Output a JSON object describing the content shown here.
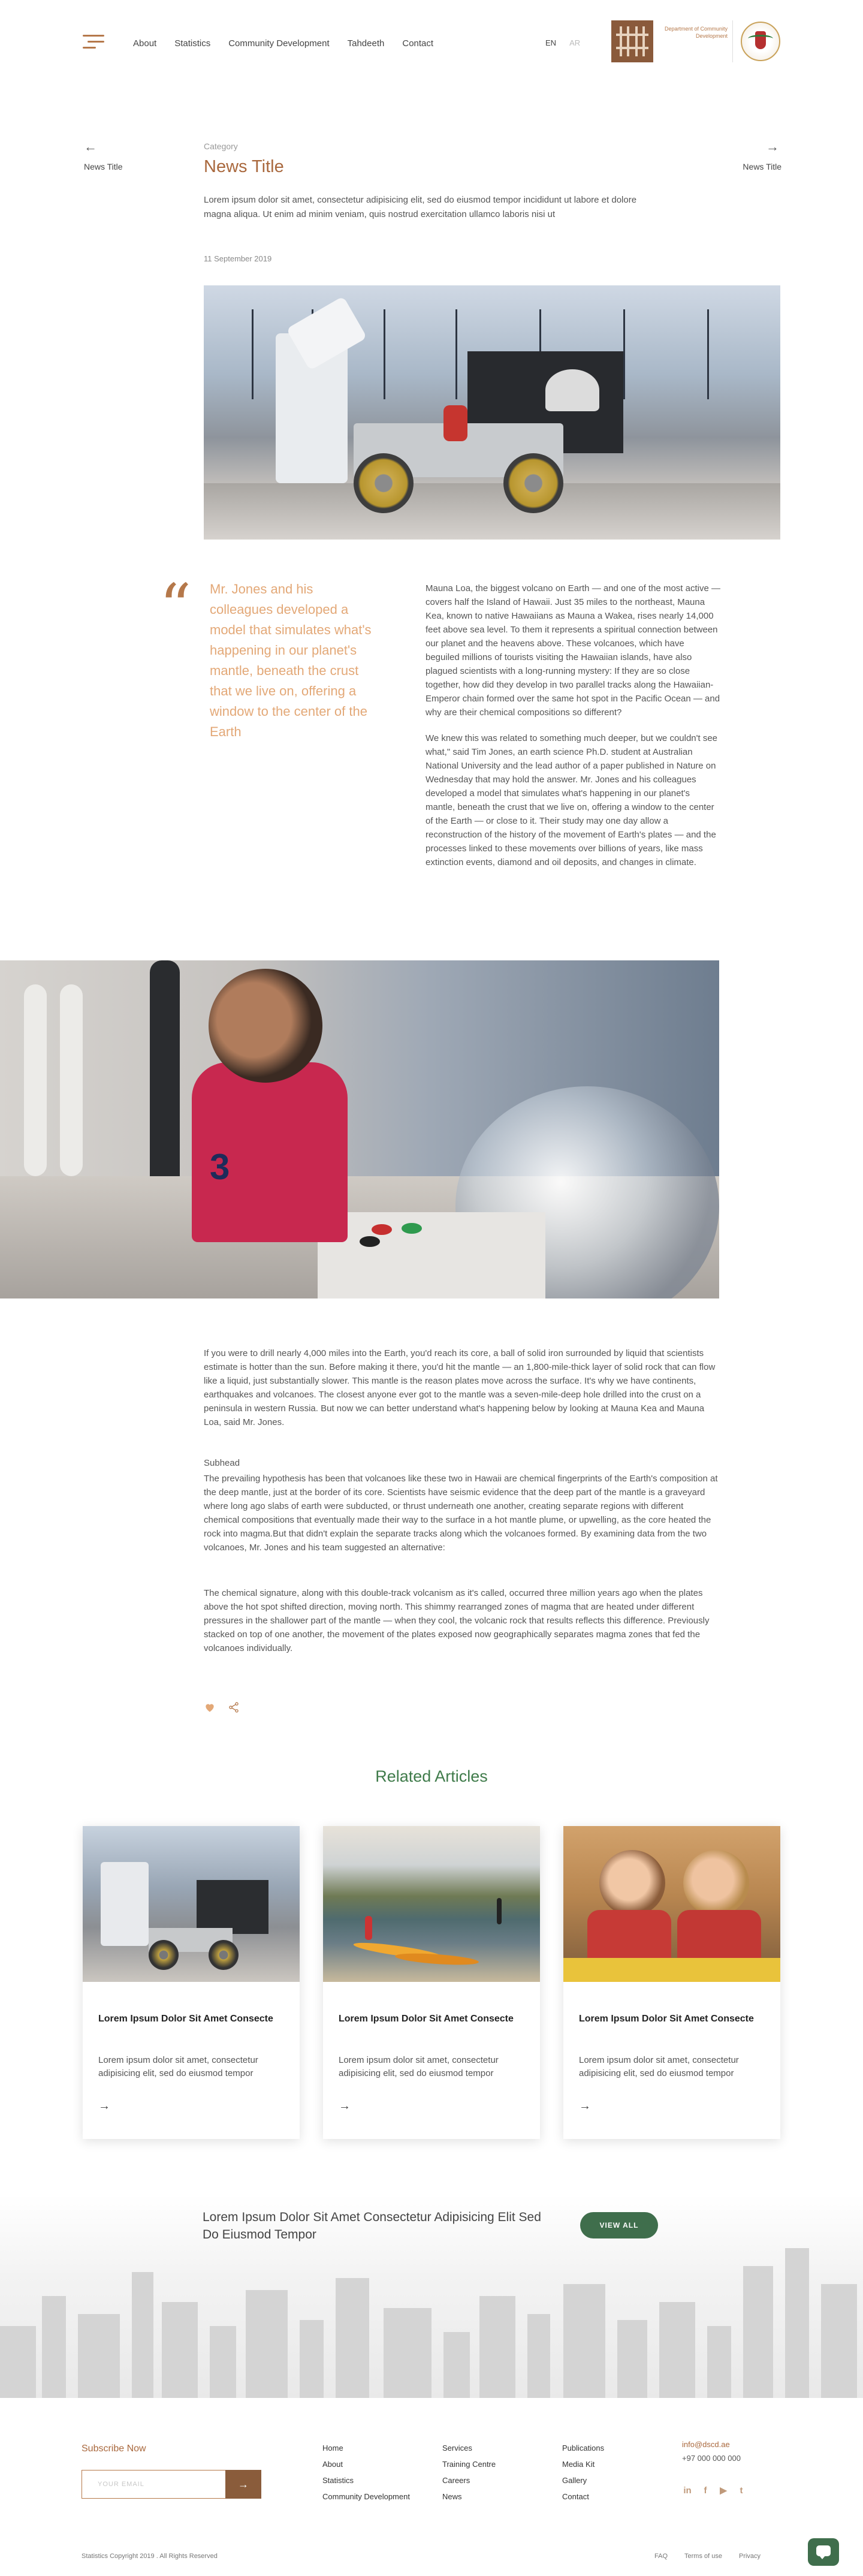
{
  "header": {
    "nav": [
      "About",
      "Statistics",
      "Community Development",
      "Tahdeeth",
      "Contact"
    ],
    "lang_en": "EN",
    "lang_ar": "AR",
    "logo_text": "Department of Community Development",
    "menu_icon": "hamburger-menu-icon"
  },
  "article_nav": {
    "prev_label": "News Title",
    "next_label": "News Title",
    "prev_icon": "arrow-left-icon",
    "next_icon": "arrow-right-icon"
  },
  "article": {
    "category": "Category",
    "title": "News Title",
    "intro": "Lorem ipsum dolor sit amet, consectetur adipisicing elit, sed do eiusmod tempor incididunt ut labore et dolore magna aliqua. Ut enim ad minim veniam, quis nostrud exercitation ullamco laboris nisi ut",
    "date": "11 September 2019",
    "pull_quote": "Mr. Jones and his colleagues developed a model that simulates what's happening in our planet's mantle, beneath the crust that we live on, offering a window to the center of the Earth",
    "body_p1": "Mauna Loa, the biggest volcano on Earth — and one of the most active — covers half the Island of Hawaii. Just 35 miles to the northeast, Mauna Kea, known to native Hawaiians as Mauna a Wakea, rises nearly 14,000 feet above sea level. To them it represents a spiritual connection between our planet and the heavens above. These volcanoes, which have beguiled millions of tourists visiting the Hawaiian islands, have also plagued scientists with a long-running mystery: If they are so close together, how did they develop in two parallel tracks along the Hawaiian-Emperor chain formed over the same hot spot in the Pacific Ocean — and why are their chemical compositions so different?",
    "body_p2": "We knew this was related to something much deeper, but we couldn't see what,\" said Tim Jones, an earth science Ph.D. student at Australian National University and the lead author of a paper published in Nature on Wednesday that may hold the answer. Mr. Jones and his colleagues developed a model that simulates what's happening in our planet's mantle, beneath the crust that we live on, offering a window to the center of the Earth — or close to it. Their study may one day allow a reconstruction of the history of the movement of Earth's plates — and the processes linked to these movements over billions of years, like mass extinction events, diamond and oil deposits, and changes in climate.",
    "body_p3": "If you were to drill nearly 4,000 miles into the Earth, you'd reach its core, a ball of solid iron surrounded by liquid that scientists estimate is hotter than the sun. Before making it there, you'd hit the mantle — an 1,800-mile-thick layer of solid rock that can flow like a liquid, just substantially slower. This mantle is the reason plates move across the surface. It's why we have continents, earthquakes and volcanoes. The closest anyone ever got to the mantle was a seven-mile-deep hole drilled into the crust on a peninsula in western Russia. But now we can better understand what's happening below by looking at Mauna Kea and Mauna Loa, said Mr. Jones.",
    "subhead": "Subhead",
    "body_p4": "The prevailing hypothesis has been that volcanoes like these two in Hawaii are chemical fingerprints of the Earth's composition at the deep mantle, just at the border of its core. Scientists have seismic evidence that the deep part of the mantle is a graveyard where long ago slabs of earth were subducted, or thrust underneath one another, creating separate regions with different chemical compositions that eventually made their way to the surface in a hot mantle plume, or upwelling, as the core heated the rock into magma.But that didn't explain the separate tracks along which the volcanoes formed. By examining data from the two volcanoes, Mr. Jones and his team suggested an alternative:",
    "body_p5": "The chemical signature, along with this double-track volcanism as it's called, occurred three million years ago when the plates above the hot spot shifted direction, moving north. This shimmy rearranged zones of magma that are heated under different pressures in the shallower part of the mantle — when they cool, the volcanic rock that results reflects this difference. Previously stacked on top of one another, the movement of the plates exposed now geographically separates magma zones that fed the volcanoes individually.",
    "like_icon": "heart-icon",
    "share_icon": "share-icon"
  },
  "related": {
    "title": "Related Articles",
    "cards": [
      {
        "title": "Lorem Ipsum Dolor Sit Amet Consecte",
        "desc": "Lorem ipsum dolor sit amet, consectetur adipisicing elit, sed do eiusmod tempor"
      },
      {
        "title": "Lorem Ipsum Dolor Sit Amet Consecte",
        "desc": "Lorem ipsum dolor sit amet, consectetur adipisicing elit, sed do eiusmod tempor"
      },
      {
        "title": "Lorem Ipsum Dolor Sit Amet Consecte",
        "desc": "Lorem ipsum dolor sit amet, consectetur adipisicing elit, sed do eiusmod tempor"
      }
    ]
  },
  "cta": {
    "text": "Lorem Ipsum Dolor Sit Amet Consectetur Adipisicing Elit Sed Do Eiusmod Tempor",
    "button": "VIEW ALL"
  },
  "footer": {
    "subscribe_title": "Subscribe Now",
    "email_placeholder": "YOUR EMAIL",
    "col1": [
      "Home",
      "About",
      "Statistics",
      "Community Development"
    ],
    "col2": [
      "Services",
      "Training Centre",
      "Careers",
      "News"
    ],
    "col3": [
      "Publications",
      "Media Kit",
      "Gallery",
      "Contact"
    ],
    "email": "info@dscd.ae",
    "phone": "+97 000 000 000",
    "socials": [
      "linkedin-icon",
      "facebook-icon",
      "youtube-icon",
      "twitter-icon"
    ],
    "copyright": "Statistics Copyright 2019 . All Rights Reserved",
    "legal": [
      "FAQ",
      "Terms of use",
      "Privacy"
    ]
  },
  "colors": {
    "accent_brown": "#a9683d",
    "quote_orange": "#e3a877",
    "green": "#3f6e4c"
  }
}
